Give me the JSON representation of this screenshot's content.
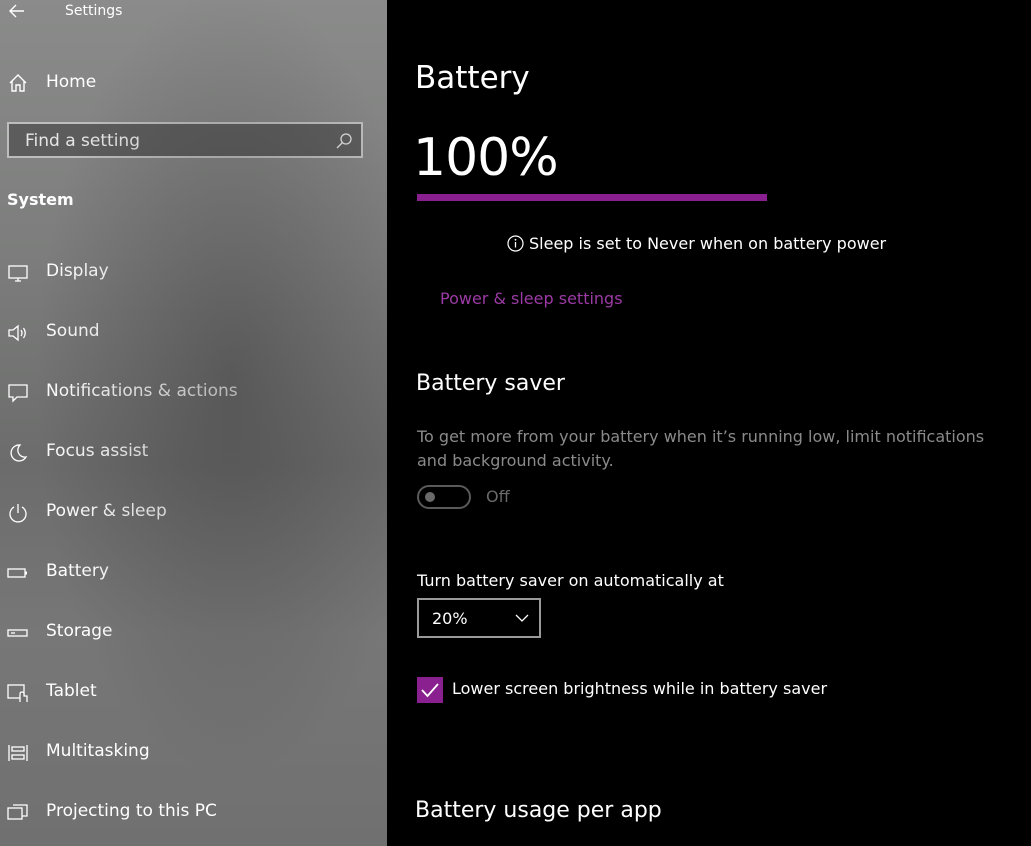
{
  "app": {
    "title": "Settings"
  },
  "sidebar": {
    "home_label": "Home",
    "search_placeholder": "Find a setting",
    "section": "System",
    "items": [
      {
        "label": "Display",
        "icon": "monitor-icon"
      },
      {
        "label": "Sound",
        "icon": "speaker-icon"
      },
      {
        "label": "Notifications & actions",
        "icon": "notification-icon"
      },
      {
        "label": "Focus assist",
        "icon": "moon-icon"
      },
      {
        "label": "Power & sleep",
        "icon": "power-icon"
      },
      {
        "label": "Battery",
        "icon": "battery-icon"
      },
      {
        "label": "Storage",
        "icon": "storage-icon"
      },
      {
        "label": "Tablet",
        "icon": "tablet-icon"
      },
      {
        "label": "Multitasking",
        "icon": "multitasking-icon"
      },
      {
        "label": "Projecting to this PC",
        "icon": "projecting-icon"
      }
    ]
  },
  "main": {
    "title": "Battery",
    "percent_text": "100%",
    "charge_level": 1.0,
    "info_text": "Sleep is set to Never when on battery power",
    "power_link": "Power & sleep settings",
    "saver": {
      "heading": "Battery saver",
      "description": "To get more from your battery when it’s running low, limit notifications and background activity.",
      "toggle_state": "Off",
      "auto_label": "Turn battery saver on automatically at",
      "auto_value": "20%",
      "brightness_label": "Lower screen brightness while in battery saver",
      "brightness_checked": true
    },
    "usage_heading": "Battery usage per app"
  },
  "colors": {
    "accent": "#8a1f8f",
    "link": "#9b3aa4",
    "sidebar_bg": "#7a7b7a"
  }
}
